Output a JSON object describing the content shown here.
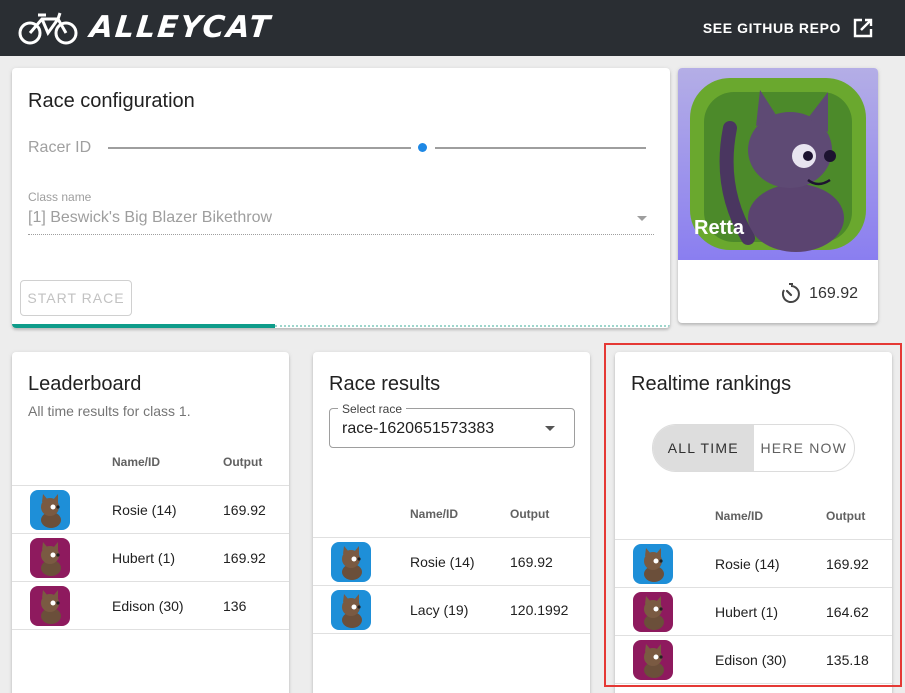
{
  "header": {
    "brand": "ALLEYCAT",
    "repo_link": "SEE GITHUB REPO",
    "colors": {
      "appbar": "#2a2e33",
      "accent": "#0e9c8a",
      "slider": "#1e88e5",
      "highlight": "#e53935"
    }
  },
  "config": {
    "title": "Race configuration",
    "racer_label": "Racer ID",
    "class_label": "Class name",
    "class_value": "[1] Beswick's Big Blazer Bikethrow",
    "start_button": "START RACE",
    "progress_fraction": 0.4
  },
  "racer": {
    "name": "Retta",
    "output": "169.92",
    "icon": "timer-icon"
  },
  "leaderboard": {
    "title": "Leaderboard",
    "subtitle": "All time results for class 1.",
    "columns": [
      "Name/ID",
      "Output"
    ],
    "rows": [
      {
        "name": "Rosie (14)",
        "output": "169.92",
        "avatar_color": "#1e8fd8"
      },
      {
        "name": "Hubert (1)",
        "output": "169.92",
        "avatar_color": "#8e1a5e"
      },
      {
        "name": "Edison (30)",
        "output": "136",
        "avatar_color": "#8e1a5e"
      }
    ]
  },
  "results": {
    "title": "Race results",
    "select_label": "Select race",
    "select_value": "race-1620651573383",
    "columns": [
      "Name/ID",
      "Output"
    ],
    "rows": [
      {
        "name": "Rosie (14)",
        "output": "169.92",
        "avatar_color": "#1e8fd8"
      },
      {
        "name": "Lacy (19)",
        "output": "120.1992",
        "avatar_color": "#1e8fd8"
      }
    ]
  },
  "rankings": {
    "title": "Realtime rankings",
    "toggle": [
      "ALL TIME",
      "HERE NOW"
    ],
    "columns": [
      "Name/ID",
      "Output"
    ],
    "rows": [
      {
        "name": "Rosie (14)",
        "output": "169.92",
        "avatar_color": "#1e8fd8"
      },
      {
        "name": "Hubert (1)",
        "output": "164.62",
        "avatar_color": "#8e1a5e"
      },
      {
        "name": "Edison (30)",
        "output": "135.18",
        "avatar_color": "#8e1a5e"
      }
    ]
  }
}
